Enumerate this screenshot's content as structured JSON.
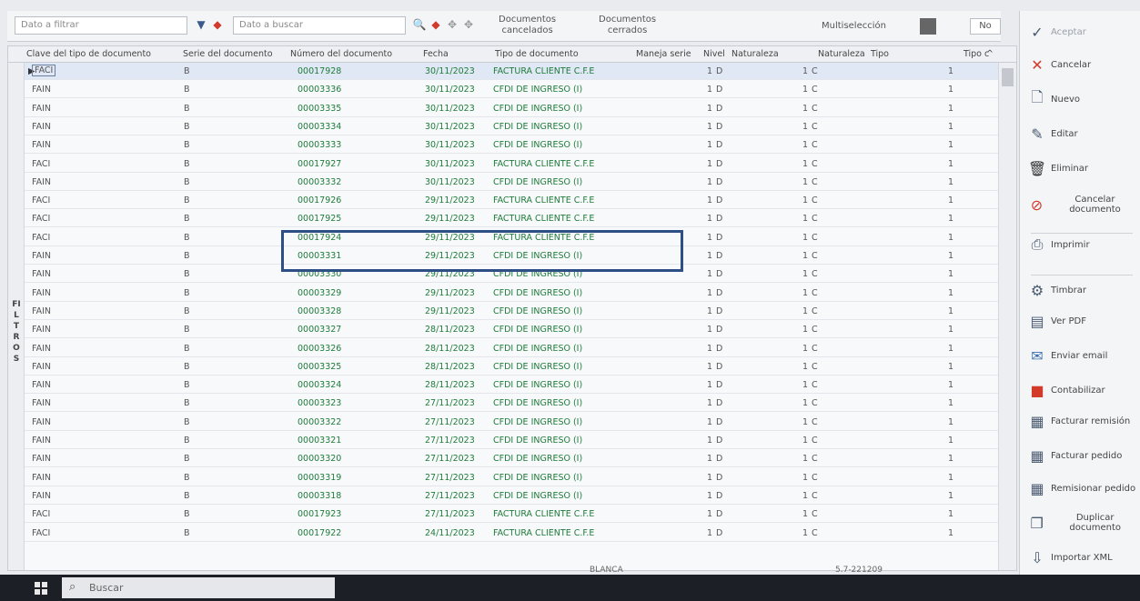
{
  "toolbar": {
    "filter_placeholder": "Dato a filtrar",
    "search_placeholder": "Dato a buscar",
    "docs_cancelados": "Documentos\ncancelados",
    "docs_cerrados": "Documentos\ncerrados",
    "multiseleccion_label": "Multiselección",
    "multiseleccion_value": "No"
  },
  "columns": [
    "Clave del tipo de documento",
    "Serie del documento",
    "Número del documento",
    "Fecha",
    "Tipo de documento",
    "Maneja serie",
    "Nivel",
    "Naturaleza",
    "Naturaleza",
    "Tipo",
    "Tipo c"
  ],
  "filter_strip_label": "FILTROS",
  "rows": [
    {
      "clave": "FACI",
      "serie": "B",
      "numero": "00017928",
      "fecha": "30/11/2023",
      "tipo": "FACTURA CLIENTE C.F.E",
      "maneja": "1",
      "nivel": "D",
      "nat": "1",
      "natv": "C",
      "tipon": "1"
    },
    {
      "clave": "FAIN",
      "serie": "B",
      "numero": "00003336",
      "fecha": "30/11/2023",
      "tipo": "CFDI DE INGRESO (I)",
      "maneja": "1",
      "nivel": "D",
      "nat": "1",
      "natv": "C",
      "tipon": "1"
    },
    {
      "clave": "FAIN",
      "serie": "B",
      "numero": "00003335",
      "fecha": "30/11/2023",
      "tipo": "CFDI DE INGRESO (I)",
      "maneja": "1",
      "nivel": "D",
      "nat": "1",
      "natv": "C",
      "tipon": "1"
    },
    {
      "clave": "FAIN",
      "serie": "B",
      "numero": "00003334",
      "fecha": "30/11/2023",
      "tipo": "CFDI DE INGRESO (I)",
      "maneja": "1",
      "nivel": "D",
      "nat": "1",
      "natv": "C",
      "tipon": "1"
    },
    {
      "clave": "FAIN",
      "serie": "B",
      "numero": "00003333",
      "fecha": "30/11/2023",
      "tipo": "CFDI DE INGRESO (I)",
      "maneja": "1",
      "nivel": "D",
      "nat": "1",
      "natv": "C",
      "tipon": "1"
    },
    {
      "clave": "FACI",
      "serie": "B",
      "numero": "00017927",
      "fecha": "30/11/2023",
      "tipo": "FACTURA CLIENTE C.F.E",
      "maneja": "1",
      "nivel": "D",
      "nat": "1",
      "natv": "C",
      "tipon": "1"
    },
    {
      "clave": "FAIN",
      "serie": "B",
      "numero": "00003332",
      "fecha": "30/11/2023",
      "tipo": "CFDI DE INGRESO (I)",
      "maneja": "1",
      "nivel": "D",
      "nat": "1",
      "natv": "C",
      "tipon": "1"
    },
    {
      "clave": "FACI",
      "serie": "B",
      "numero": "00017926",
      "fecha": "29/11/2023",
      "tipo": "FACTURA CLIENTE C.F.E",
      "maneja": "1",
      "nivel": "D",
      "nat": "1",
      "natv": "C",
      "tipon": "1"
    },
    {
      "clave": "FACI",
      "serie": "B",
      "numero": "00017925",
      "fecha": "29/11/2023",
      "tipo": "FACTURA CLIENTE C.F.E",
      "maneja": "1",
      "nivel": "D",
      "nat": "1",
      "natv": "C",
      "tipon": "1"
    },
    {
      "clave": "FACI",
      "serie": "B",
      "numero": "00017924",
      "fecha": "29/11/2023",
      "tipo": "FACTURA CLIENTE C.F.E",
      "maneja": "1",
      "nivel": "D",
      "nat": "1",
      "natv": "C",
      "tipon": "1"
    },
    {
      "clave": "FAIN",
      "serie": "B",
      "numero": "00003331",
      "fecha": "29/11/2023",
      "tipo": "CFDI DE INGRESO (I)",
      "maneja": "1",
      "nivel": "D",
      "nat": "1",
      "natv": "C",
      "tipon": "1"
    },
    {
      "clave": "FAIN",
      "serie": "B",
      "numero": "00003330",
      "fecha": "29/11/2023",
      "tipo": "CFDI DE INGRESO (I)",
      "maneja": "1",
      "nivel": "D",
      "nat": "1",
      "natv": "C",
      "tipon": "1"
    },
    {
      "clave": "FAIN",
      "serie": "B",
      "numero": "00003329",
      "fecha": "29/11/2023",
      "tipo": "CFDI DE INGRESO (I)",
      "maneja": "1",
      "nivel": "D",
      "nat": "1",
      "natv": "C",
      "tipon": "1"
    },
    {
      "clave": "FAIN",
      "serie": "B",
      "numero": "00003328",
      "fecha": "29/11/2023",
      "tipo": "CFDI DE INGRESO (I)",
      "maneja": "1",
      "nivel": "D",
      "nat": "1",
      "natv": "C",
      "tipon": "1"
    },
    {
      "clave": "FAIN",
      "serie": "B",
      "numero": "00003327",
      "fecha": "28/11/2023",
      "tipo": "CFDI DE INGRESO (I)",
      "maneja": "1",
      "nivel": "D",
      "nat": "1",
      "natv": "C",
      "tipon": "1"
    },
    {
      "clave": "FAIN",
      "serie": "B",
      "numero": "00003326",
      "fecha": "28/11/2023",
      "tipo": "CFDI DE INGRESO (I)",
      "maneja": "1",
      "nivel": "D",
      "nat": "1",
      "natv": "C",
      "tipon": "1"
    },
    {
      "clave": "FAIN",
      "serie": "B",
      "numero": "00003325",
      "fecha": "28/11/2023",
      "tipo": "CFDI DE INGRESO (I)",
      "maneja": "1",
      "nivel": "D",
      "nat": "1",
      "natv": "C",
      "tipon": "1"
    },
    {
      "clave": "FAIN",
      "serie": "B",
      "numero": "00003324",
      "fecha": "28/11/2023",
      "tipo": "CFDI DE INGRESO (I)",
      "maneja": "1",
      "nivel": "D",
      "nat": "1",
      "natv": "C",
      "tipon": "1"
    },
    {
      "clave": "FAIN",
      "serie": "B",
      "numero": "00003323",
      "fecha": "27/11/2023",
      "tipo": "CFDI DE INGRESO (I)",
      "maneja": "1",
      "nivel": "D",
      "nat": "1",
      "natv": "C",
      "tipon": "1"
    },
    {
      "clave": "FAIN",
      "serie": "B",
      "numero": "00003322",
      "fecha": "27/11/2023",
      "tipo": "CFDI DE INGRESO (I)",
      "maneja": "1",
      "nivel": "D",
      "nat": "1",
      "natv": "C",
      "tipon": "1"
    },
    {
      "clave": "FAIN",
      "serie": "B",
      "numero": "00003321",
      "fecha": "27/11/2023",
      "tipo": "CFDI DE INGRESO (I)",
      "maneja": "1",
      "nivel": "D",
      "nat": "1",
      "natv": "C",
      "tipon": "1"
    },
    {
      "clave": "FAIN",
      "serie": "B",
      "numero": "00003320",
      "fecha": "27/11/2023",
      "tipo": "CFDI DE INGRESO (I)",
      "maneja": "1",
      "nivel": "D",
      "nat": "1",
      "natv": "C",
      "tipon": "1"
    },
    {
      "clave": "FAIN",
      "serie": "B",
      "numero": "00003319",
      "fecha": "27/11/2023",
      "tipo": "CFDI DE INGRESO (I)",
      "maneja": "1",
      "nivel": "D",
      "nat": "1",
      "natv": "C",
      "tipon": "1"
    },
    {
      "clave": "FAIN",
      "serie": "B",
      "numero": "00003318",
      "fecha": "27/11/2023",
      "tipo": "CFDI DE INGRESO (I)",
      "maneja": "1",
      "nivel": "D",
      "nat": "1",
      "natv": "C",
      "tipon": "1"
    },
    {
      "clave": "FACI",
      "serie": "B",
      "numero": "00017923",
      "fecha": "27/11/2023",
      "tipo": "FACTURA CLIENTE C.F.E",
      "maneja": "1",
      "nivel": "D",
      "nat": "1",
      "natv": "C",
      "tipon": "1"
    },
    {
      "clave": "FACI",
      "serie": "B",
      "numero": "00017922",
      "fecha": "24/11/2023",
      "tipo": "FACTURA CLIENTE C.F.E",
      "maneja": "1",
      "nivel": "D",
      "nat": "1",
      "natv": "C",
      "tipon": "1"
    }
  ],
  "actions": [
    {
      "label": "Aceptar",
      "icon": "check-icon",
      "disabled": true
    },
    {
      "label": "Cancelar",
      "icon": "x-icon",
      "disabled": false
    },
    {
      "label": "Nuevo",
      "icon": "new-doc-icon",
      "disabled": false
    },
    {
      "label": "Editar",
      "icon": "edit-icon",
      "disabled": false
    },
    {
      "label": "Eliminar",
      "icon": "trash-icon",
      "disabled": false
    },
    {
      "label": "Cancelar documento",
      "icon": "cancel-doc-icon",
      "disabled": false
    },
    {
      "label": "Imprimir",
      "icon": "printer-icon",
      "disabled": false
    },
    {
      "label": "Timbrar",
      "icon": "stamp-icon",
      "disabled": false
    },
    {
      "label": "Ver PDF",
      "icon": "pdf-icon",
      "disabled": false
    },
    {
      "label": "Enviar email",
      "icon": "email-icon",
      "disabled": false
    },
    {
      "label": "Contabilizar",
      "icon": "cf-icon",
      "disabled": false
    },
    {
      "label": "Facturar remisión",
      "icon": "invoice-remision-icon",
      "disabled": false
    },
    {
      "label": "Facturar pedido",
      "icon": "invoice-order-icon",
      "disabled": false
    },
    {
      "label": "Remisionar pedido",
      "icon": "remision-order-icon",
      "disabled": false
    },
    {
      "label": "Duplicar documento",
      "icon": "duplicate-icon",
      "disabled": false
    },
    {
      "label": "Importar XML",
      "icon": "import-xml-icon",
      "disabled": false
    }
  ],
  "status": {
    "blanca": "BLANCA",
    "version": "5.7-221209"
  },
  "taskbar": {
    "search_text": "Buscar"
  },
  "colors": {
    "accent_green": "#1e7c3a",
    "highlight_border": "#2d4f86",
    "cancel_red": "#d23a2a"
  }
}
